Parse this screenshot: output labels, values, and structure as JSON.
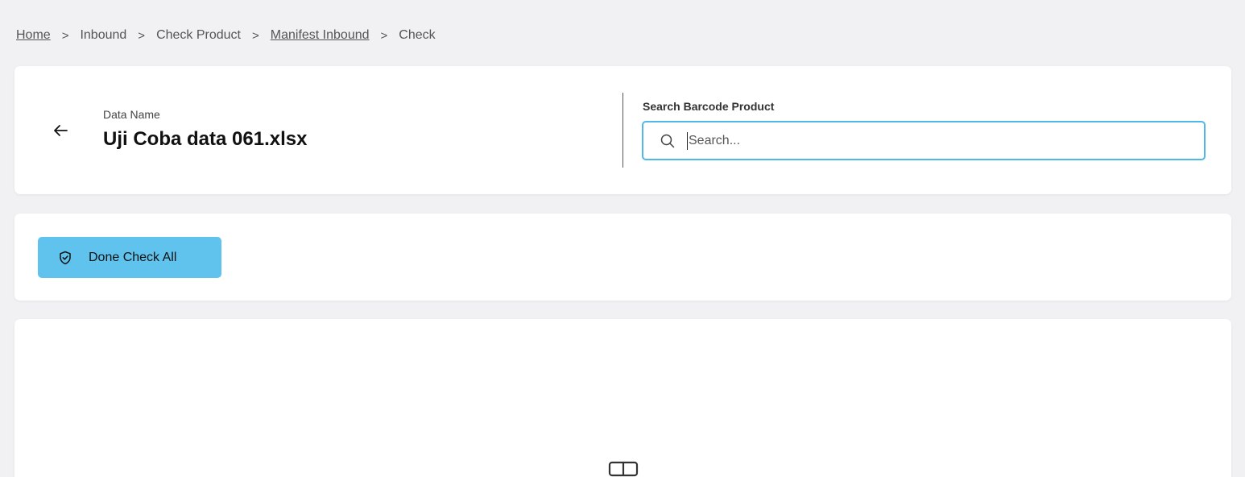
{
  "breadcrumb": {
    "items": [
      {
        "label": "Home"
      },
      {
        "label": "Inbound"
      },
      {
        "label": "Check Product"
      },
      {
        "label": "Manifest Inbound"
      },
      {
        "label": "Check"
      }
    ],
    "separator": ">"
  },
  "header": {
    "back_icon": "arrow-left-icon",
    "data_name_label": "Data Name",
    "data_name_value": "Uji Coba data 061.xlsx"
  },
  "search": {
    "label": "Search Barcode Product",
    "placeholder": "Search...",
    "value": "",
    "icon": "search-icon",
    "border_color": "#4fb8e6"
  },
  "actions": {
    "done_check_all_label": "Done Check All",
    "done_check_all_icon": "shield-check-icon",
    "button_color": "#5fc3ee"
  },
  "content": {
    "empty_icon": "columns-icon"
  }
}
